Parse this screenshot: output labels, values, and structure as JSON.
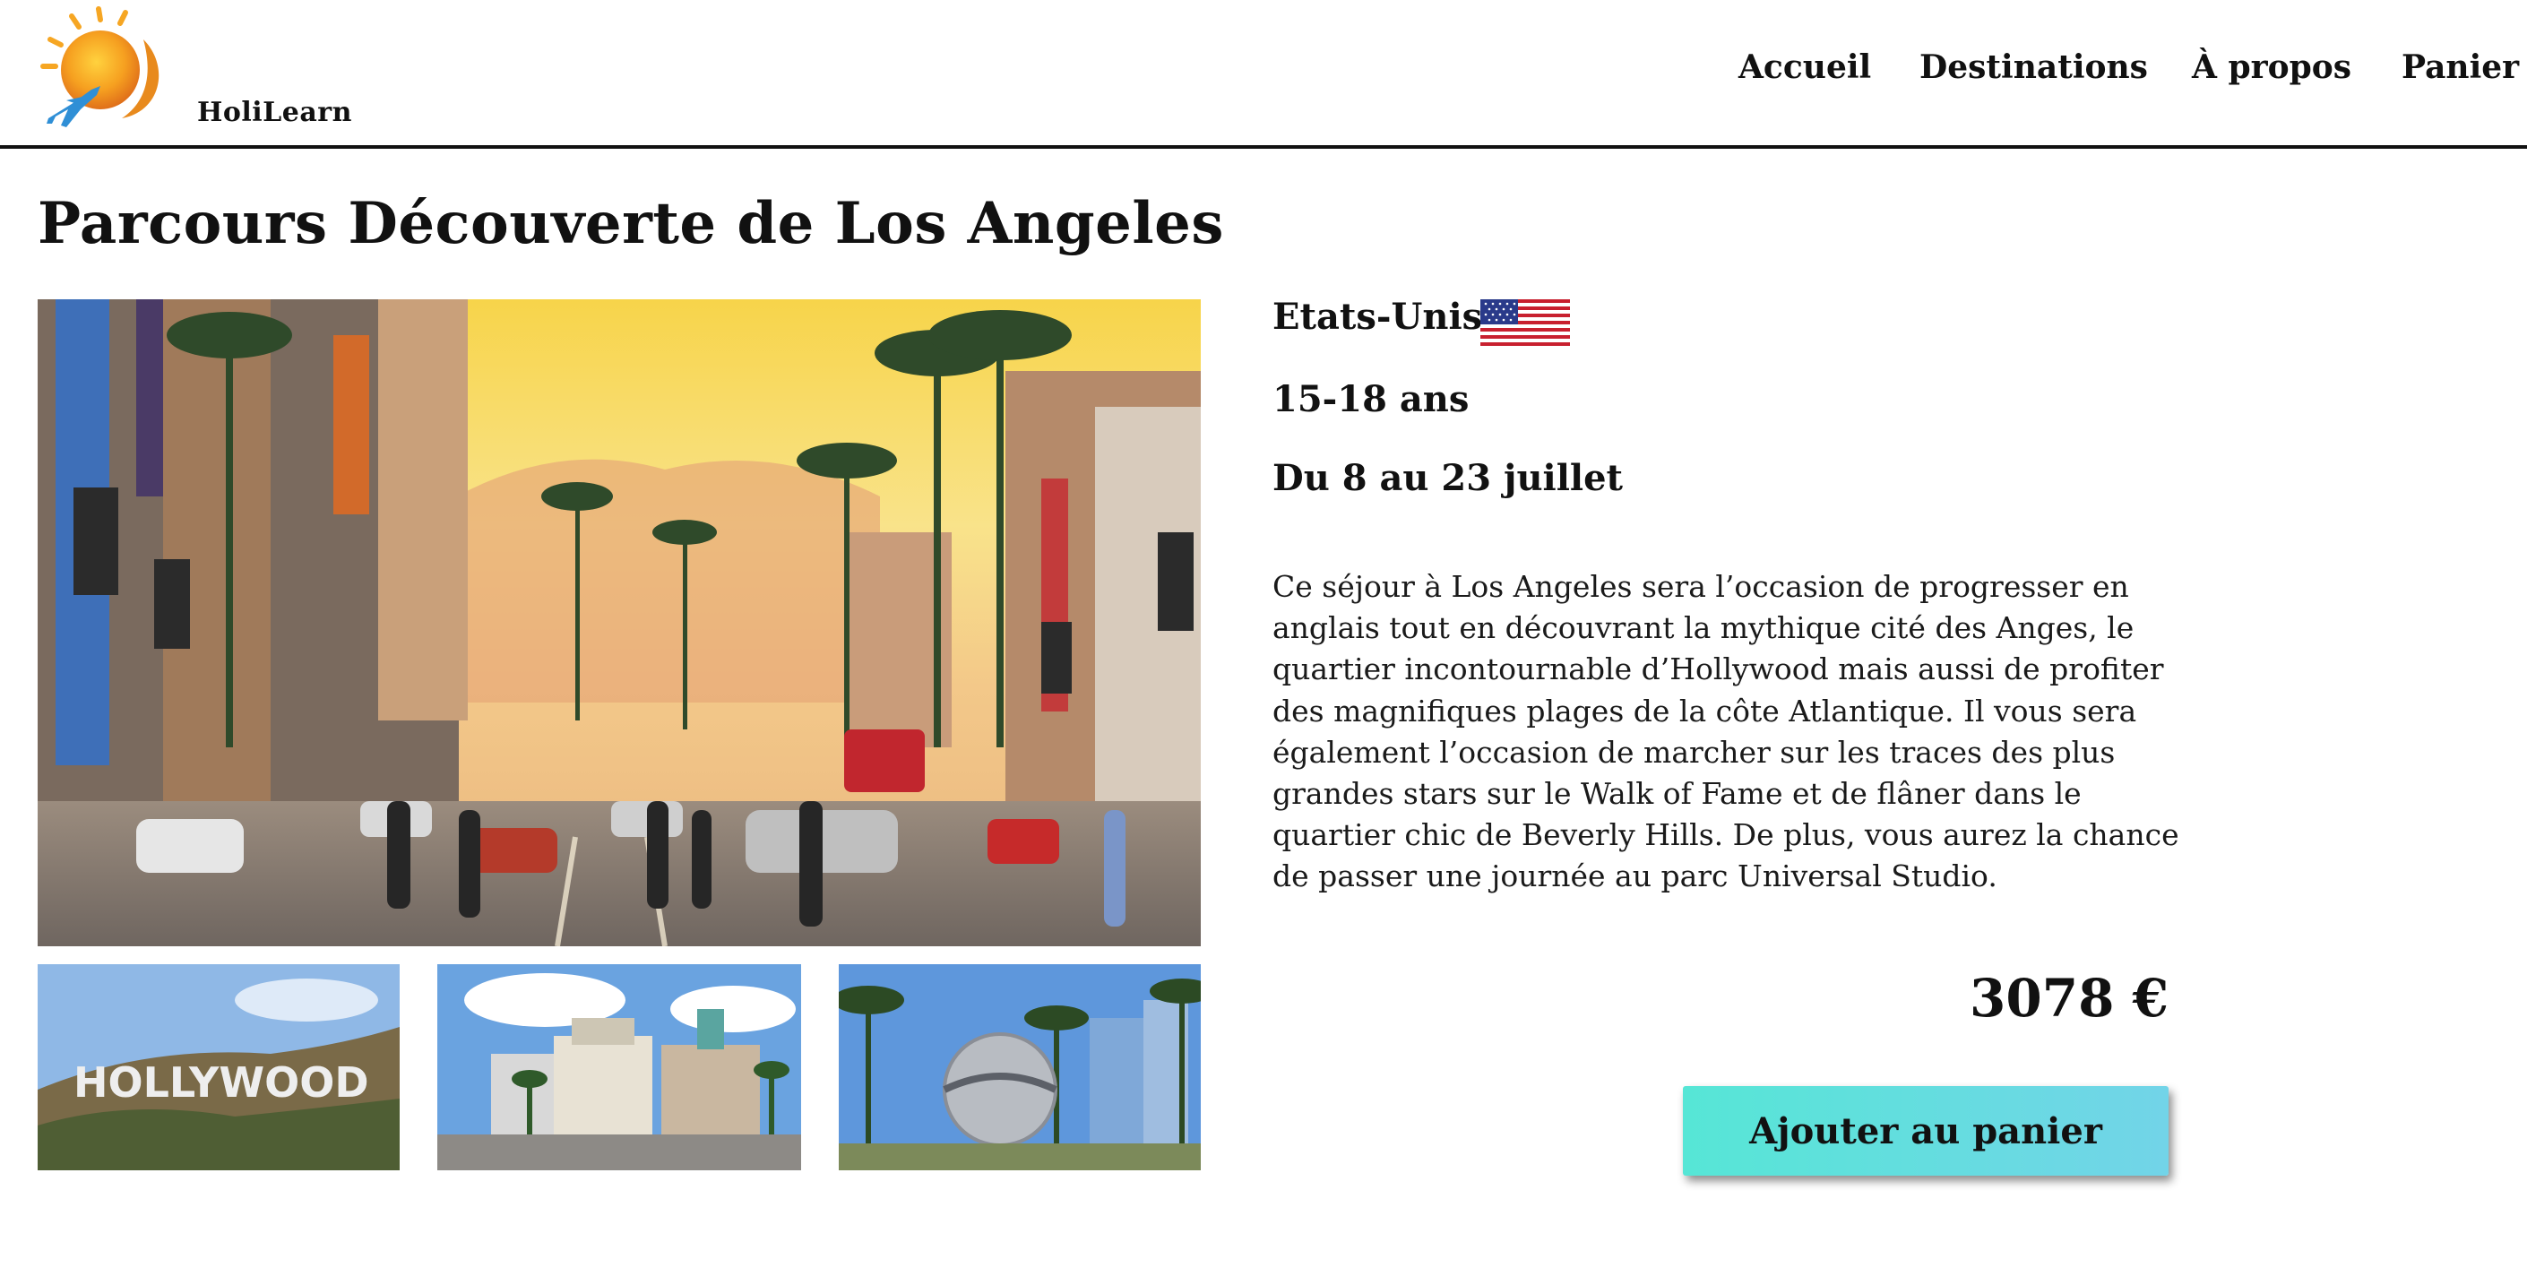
{
  "header": {
    "brand": "HoliLearn",
    "nav": {
      "accueil": "Accueil",
      "destinations": "Destinations",
      "apropos": "À propos",
      "panier": "Panier"
    }
  },
  "main": {
    "title": "Parcours Découverte de Los Angeles",
    "country": "Etats-Unis",
    "age": "15-18 ans",
    "dates": "Du 8 au 23 juillet",
    "description": "Ce séjour à Los Angeles sera l’occasion de progresser en anglais tout en découvrant la mythique cité des Anges, le quartier incontournable d’Hollywood mais aussi de profiter des magnifiques plages de la côte Atlantique. Il vous sera également l’occasion de marcher sur les traces des plus grandes stars sur le Walk of Fame et de flâner dans le quartier chic de Beverly Hills. De plus, vous aurez la chance de passer une journée au parc Universal Studio.",
    "price": "3078 €",
    "cart_button": "Ajouter au panier"
  },
  "images": {
    "main_photo": "hollywood-boulevard-photo",
    "thumbnails": [
      "hollywood-sign-photo",
      "beverly-hills-photo",
      "universal-globe-photo"
    ],
    "hollywood_sign_text": "HOLLYWOOD"
  },
  "icons": {
    "logo": "sun-airplane-logo-icon",
    "flag": "us-flag-icon"
  },
  "colors": {
    "button_gradient_start": "#56e6d6",
    "button_gradient_end": "#72d4e8",
    "logo_sun": "#f39a1e",
    "logo_plane": "#2f8fd6"
  }
}
